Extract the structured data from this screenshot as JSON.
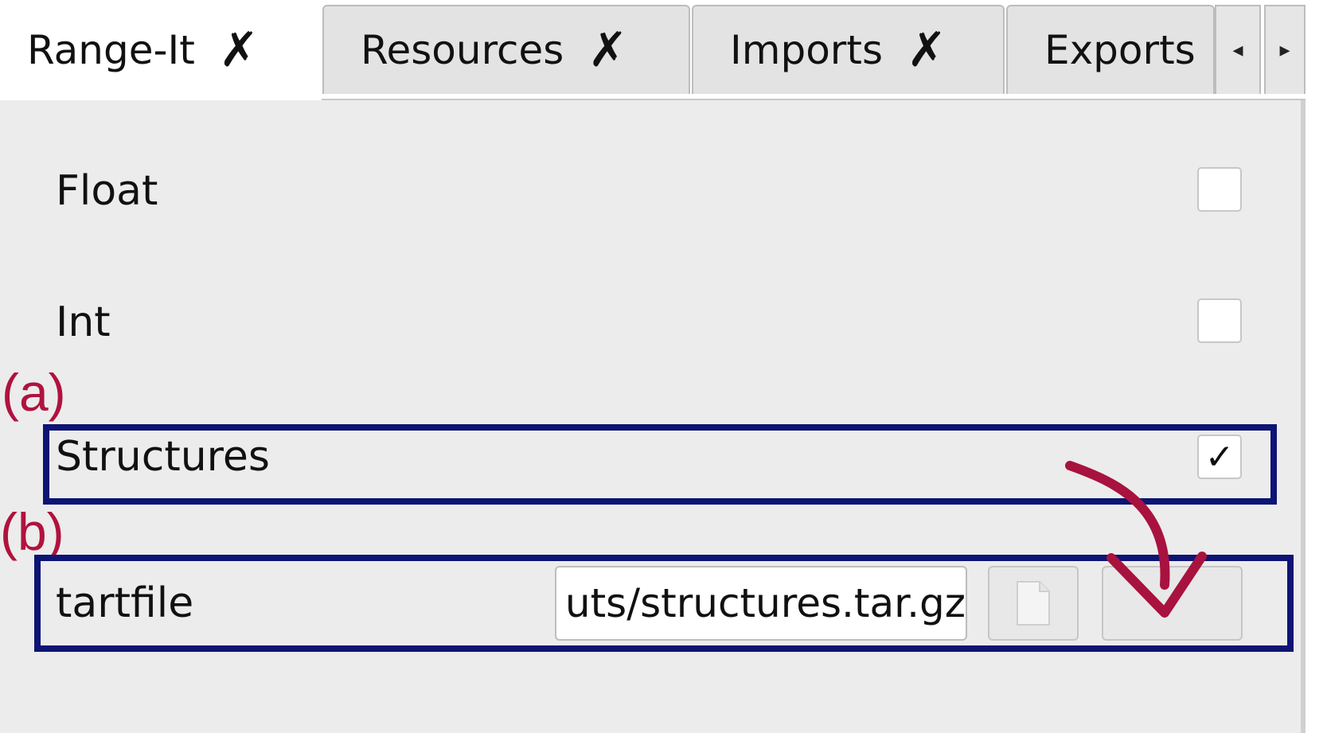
{
  "tabs": [
    {
      "label": "Range-It",
      "closable": true,
      "active": true
    },
    {
      "label": "Resources",
      "closable": true,
      "active": false
    },
    {
      "label": "Imports",
      "closable": true,
      "active": false
    },
    {
      "label": "Exports",
      "closable": false,
      "active": false
    }
  ],
  "tab_close_glyph": "✗",
  "tab_scroll": {
    "left_glyph": "◂",
    "right_glyph": "▸"
  },
  "rows": [
    {
      "label": "Float",
      "checked": false,
      "check_glyph": ""
    },
    {
      "label": "Int",
      "checked": false,
      "check_glyph": ""
    },
    {
      "label": "Structures",
      "checked": true,
      "check_glyph": "✓"
    }
  ],
  "tarfile": {
    "label": "tartfile",
    "value": "uts/structures.tar.gz",
    "browse_icon": "file-icon",
    "open_icon": "blank"
  },
  "annotations": {
    "a_label": "(a)",
    "b_label": "(b)",
    "box_color": "#0d1473",
    "label_color": "#b0123e",
    "arrow_color": "#a8123e"
  }
}
